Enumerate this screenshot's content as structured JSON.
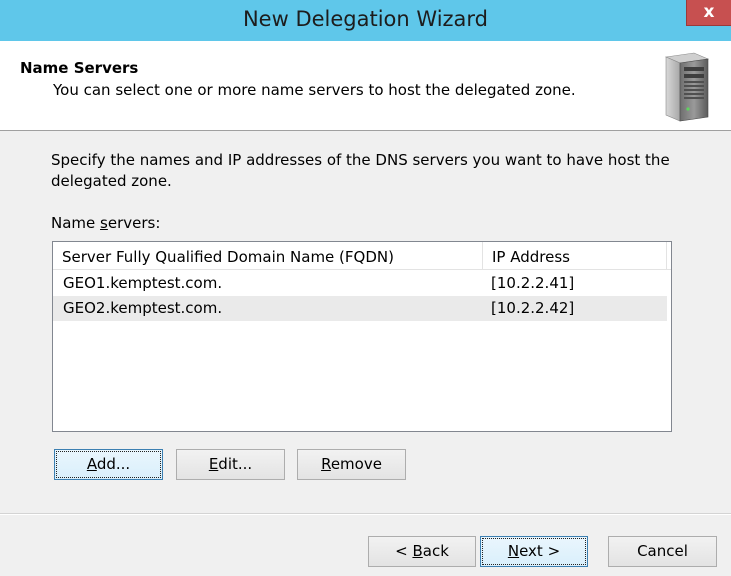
{
  "window": {
    "title": "New Delegation Wizard",
    "close_glyph": "x"
  },
  "header": {
    "title": "Name Servers",
    "subtitle": "You can select one or more name servers to host the delegated zone.",
    "icon": "server-tower-icon"
  },
  "body": {
    "instruction": "Specify the names and IP addresses of the DNS servers you want to have host the delegated zone.",
    "list_label_prefix": "Name ",
    "list_label_mnemonic": "s",
    "list_label_suffix": "ervers:"
  },
  "list": {
    "columns": [
      "Server Fully Qualified Domain Name (FQDN)",
      "IP Address"
    ],
    "rows": [
      {
        "fqdn": "GEO1.kemptest.com.",
        "ip": "[10.2.2.41]"
      },
      {
        "fqdn": "GEO2.kemptest.com.",
        "ip": "[10.2.2.42]"
      }
    ]
  },
  "buttons": {
    "add": {
      "mnemonic": "A",
      "rest": "dd..."
    },
    "edit": {
      "mnemonic": "E",
      "rest": "dit..."
    },
    "remove": {
      "mnemonic": "R",
      "rest": "emove"
    },
    "back": {
      "pre": "< ",
      "mnemonic": "B",
      "rest": "ack"
    },
    "next": {
      "mnemonic": "N",
      "rest": "ext >"
    },
    "cancel": {
      "label": "Cancel"
    }
  }
}
